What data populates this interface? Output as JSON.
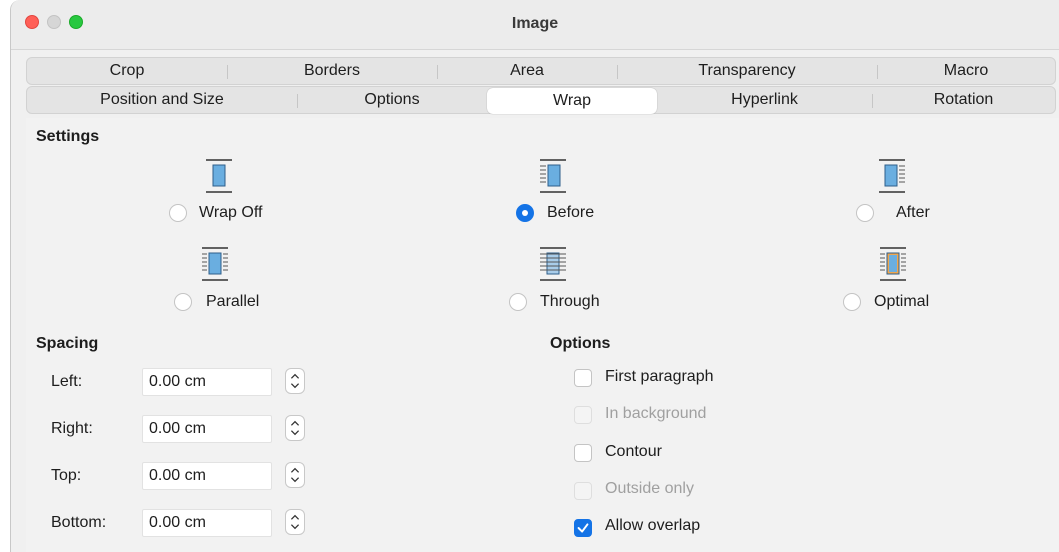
{
  "window": {
    "title": "Image"
  },
  "tabs": {
    "row1": [
      {
        "label": "Crop"
      },
      {
        "label": "Borders"
      },
      {
        "label": "Area"
      },
      {
        "label": "Transparency"
      },
      {
        "label": "Macro"
      }
    ],
    "row2": [
      {
        "label": "Position and Size"
      },
      {
        "label": "Options"
      },
      {
        "label": "Wrap",
        "selected": true
      },
      {
        "label": "Hyperlink"
      },
      {
        "label": "Rotation"
      }
    ]
  },
  "settings": {
    "title": "Settings",
    "options": [
      {
        "label": "Wrap Off",
        "icon": "wrap-off-icon",
        "selected": false
      },
      {
        "label": "Before",
        "icon": "wrap-before-icon",
        "selected": true
      },
      {
        "label": "After",
        "icon": "wrap-after-icon",
        "selected": false
      },
      {
        "label": "Parallel",
        "icon": "wrap-parallel-icon",
        "selected": false
      },
      {
        "label": "Through",
        "icon": "wrap-through-icon",
        "selected": false
      },
      {
        "label": "Optimal",
        "icon": "wrap-optimal-icon",
        "selected": false
      }
    ]
  },
  "spacing": {
    "title": "Spacing",
    "fields": [
      {
        "label": "Left:",
        "value": "0.00 cm"
      },
      {
        "label": "Right:",
        "value": "0.00 cm"
      },
      {
        "label": "Top:",
        "value": "0.00 cm"
      },
      {
        "label": "Bottom:",
        "value": "0.00 cm"
      }
    ]
  },
  "options": {
    "title": "Options",
    "checkboxes": [
      {
        "label": "First paragraph",
        "checked": false,
        "enabled": true
      },
      {
        "label": "In background",
        "checked": false,
        "enabled": false
      },
      {
        "label": "Contour",
        "checked": false,
        "enabled": true
      },
      {
        "label": "Outside only",
        "checked": false,
        "enabled": false
      },
      {
        "label": "Allow overlap",
        "checked": true,
        "enabled": true
      }
    ]
  },
  "colors": {
    "accent": "#1473e6",
    "icon_fill": "#6aaee0",
    "optimal_fill": "#f0a64e"
  }
}
